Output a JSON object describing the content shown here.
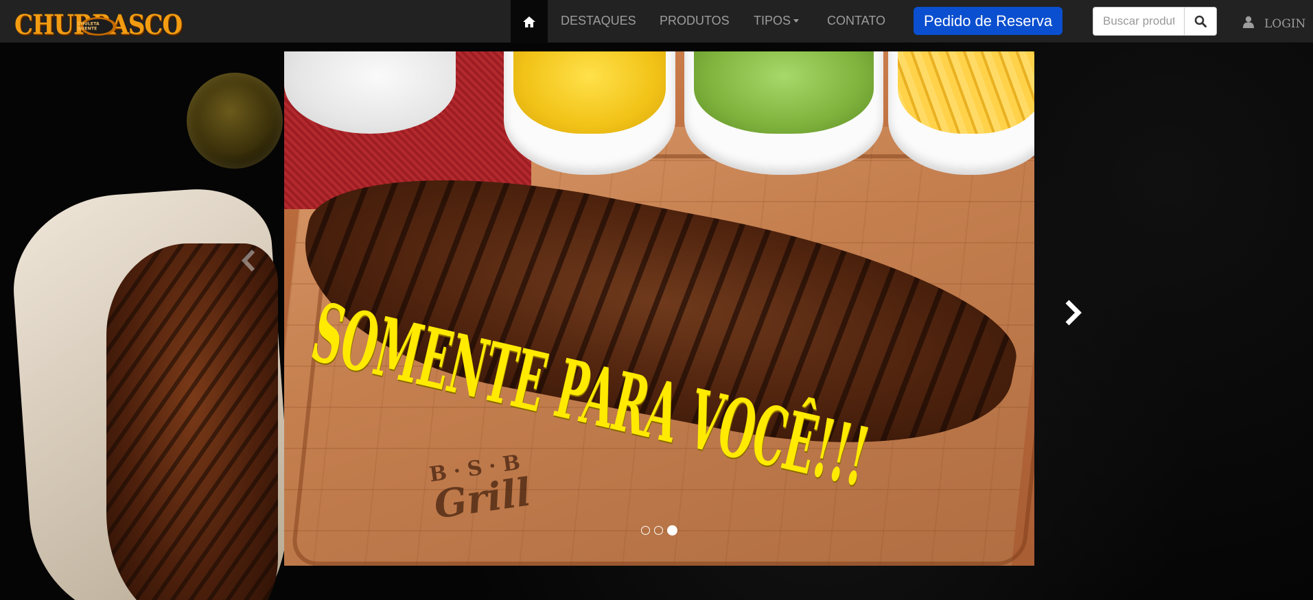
{
  "logo": {
    "text_left": "CHUR",
    "text_right": "RASCO",
    "badge": "CHULETA QUENTE"
  },
  "nav": {
    "home_icon": "home-icon",
    "items": [
      {
        "label": "DESTAQUES"
      },
      {
        "label": "PRODUTOS"
      },
      {
        "label": "TIPOS",
        "has_dropdown": true
      },
      {
        "label": "CONTATO"
      }
    ],
    "reserve_button": "Pedido de Reserva",
    "search": {
      "placeholder": "Buscar produtos",
      "icon": "search-icon"
    },
    "login": {
      "icon": "user-icon",
      "label": "LOGIN"
    }
  },
  "carousel": {
    "slogan": "SOMENTE PARA VOCÊ!!!",
    "brand_top": "B·S·B",
    "brand_bottom": "Grill",
    "prev_icon": "chevron-left-icon",
    "next_icon": "chevron-right-icon",
    "slide_count": 3,
    "active_index": 3
  },
  "colors": {
    "navbar_bg": "#222222",
    "nav_text": "#9d9d9d",
    "reserve_button_bg": "#0a4fcf",
    "slogan": "#ffea00",
    "logo_text": "#f39c12"
  }
}
